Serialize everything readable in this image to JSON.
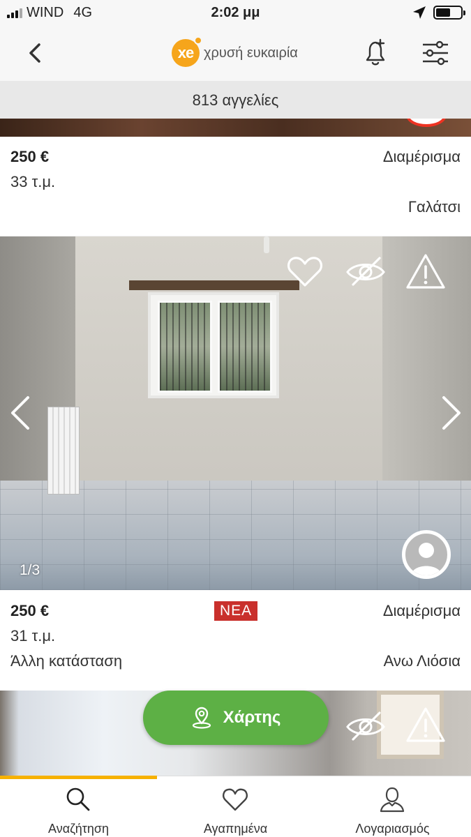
{
  "status_bar": {
    "carrier": "WIND",
    "network": "4G",
    "time": "2:02 μμ"
  },
  "header": {
    "logo_mark": "xe",
    "logo_text": "χρυσή ευκαιρία"
  },
  "listing_count": "813 αγγελίες",
  "listings": [
    {
      "price": "250 €",
      "type": "Διαμέρισμα",
      "area": "33 τ.μ.",
      "location": "Γαλάτσι"
    },
    {
      "price": "250 €",
      "badge": "ΝΕΑ",
      "type": "Διαμέρισμα",
      "area": "31 τ.μ.",
      "condition": "Άλλη κατάσταση",
      "location": "Ανω Λιόσια",
      "photo_counter": "1/3"
    }
  ],
  "map_button": {
    "label": "Χάρτης",
    "icon": "map-pin-icon"
  },
  "tabs": [
    {
      "label": "Αναζήτηση",
      "icon": "search-icon",
      "active": true
    },
    {
      "label": "Αγαπημένα",
      "icon": "heart-icon",
      "active": false
    },
    {
      "label": "Λογαριασμός",
      "icon": "user-icon",
      "active": false
    }
  ],
  "colors": {
    "brand": "#f6a51b",
    "map_button": "#5db045",
    "new_badge": "#c9302c",
    "tab_indicator": "#f6b100"
  }
}
